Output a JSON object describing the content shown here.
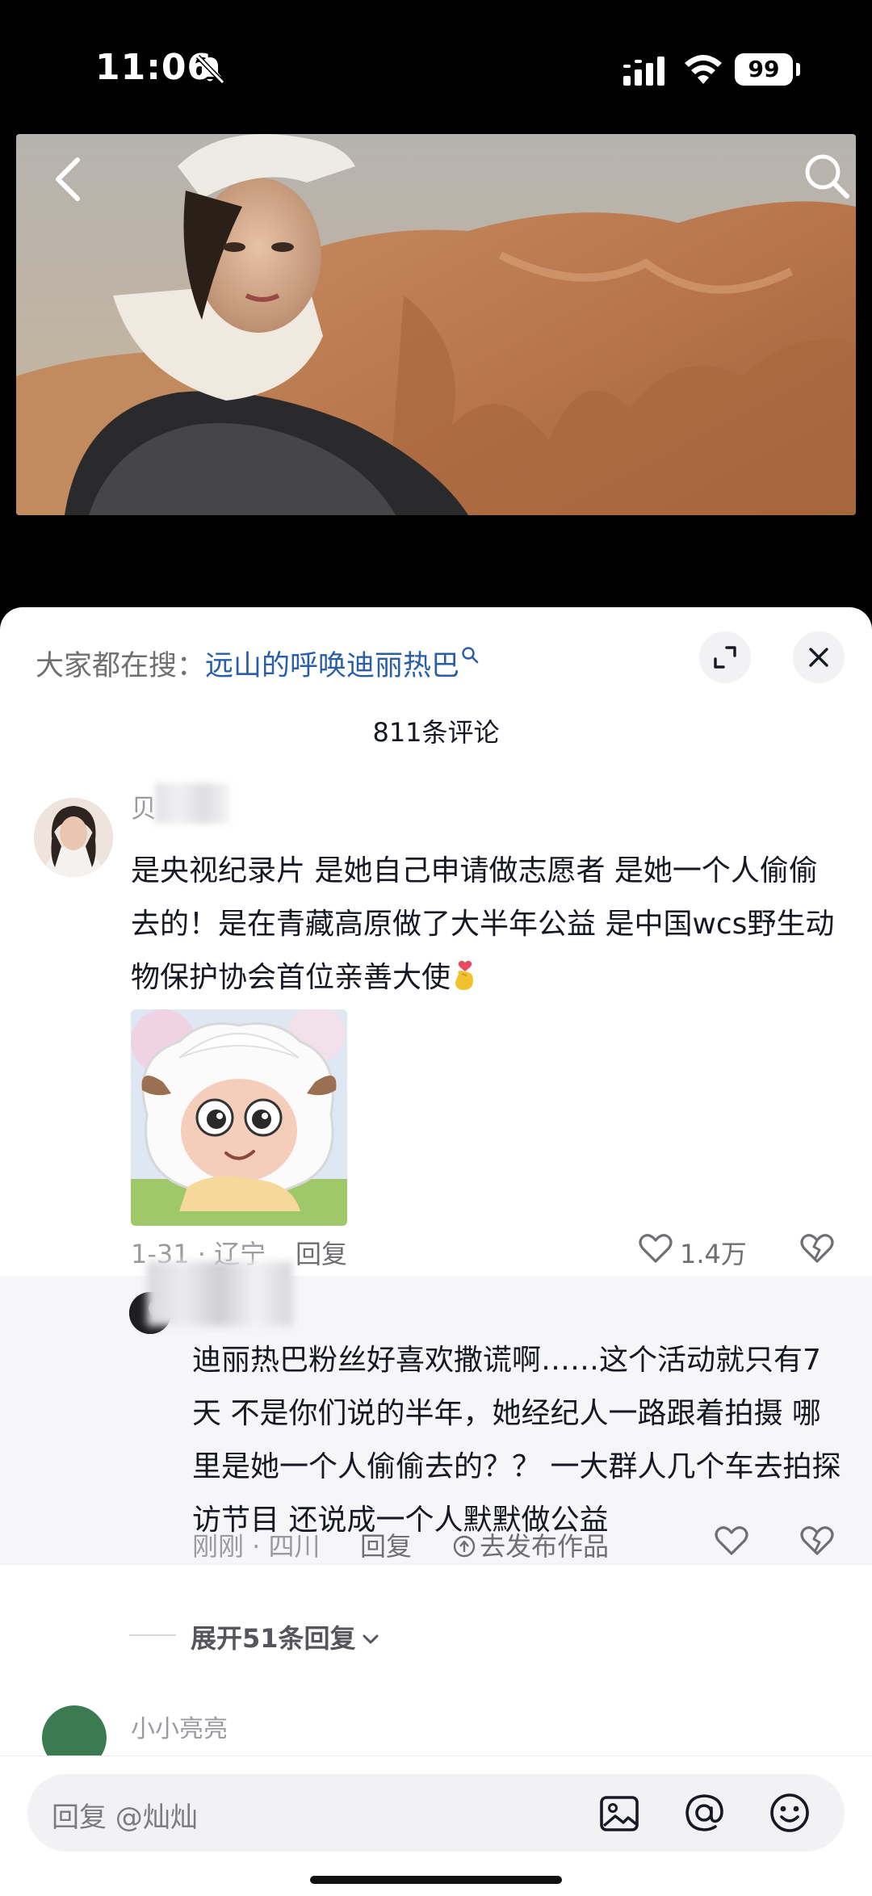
{
  "status_bar": {
    "time": "11:06",
    "battery": "99"
  },
  "search_hint": {
    "prefix": "大家都在搜：",
    "keyword": "远山的呼唤迪丽热巴"
  },
  "comments": {
    "count_label": "811条评论",
    "main": {
      "username_partial": "贝",
      "text": "是央视纪录片 是她自己申请做志愿者 是她一个人偷偷去的！是在青藏高原做了大半年公益 是中国wcs野生动物保护协会首位亲善大使",
      "meta": "1-31 · 辽宁",
      "reply_label": "回复",
      "like_count": "1.4万"
    },
    "reply": {
      "text": "迪丽热巴粉丝好喜欢撒谎啊……这个活动就只有7天 不是你们说的半年，她经纪人一路跟着拍摄 哪里是她一个人偷偷去的？？ 一大群人几个车去拍探访节目 还说成一个人默默做公益",
      "meta": "刚刚 · 四川",
      "reply_label": "回复",
      "publish_label": "去发布作品"
    },
    "expand_label": "展开51条回复",
    "next_username_partial": "小小亮亮"
  },
  "input": {
    "placeholder": "回复 @灿灿"
  },
  "colors": {
    "keyword": "#2a5ea8",
    "muted": "#9a9ba0",
    "sheet_bg": "#ffffff",
    "reply_bg": "#f6f6f8"
  },
  "icons": [
    "mute-icon",
    "signal-icon",
    "wifi-icon",
    "back-icon",
    "search-icon",
    "expand-icon",
    "close-icon",
    "heart-icon",
    "dislike-icon",
    "image-icon",
    "at-icon",
    "emoji-icon",
    "chevron-down-icon"
  ]
}
